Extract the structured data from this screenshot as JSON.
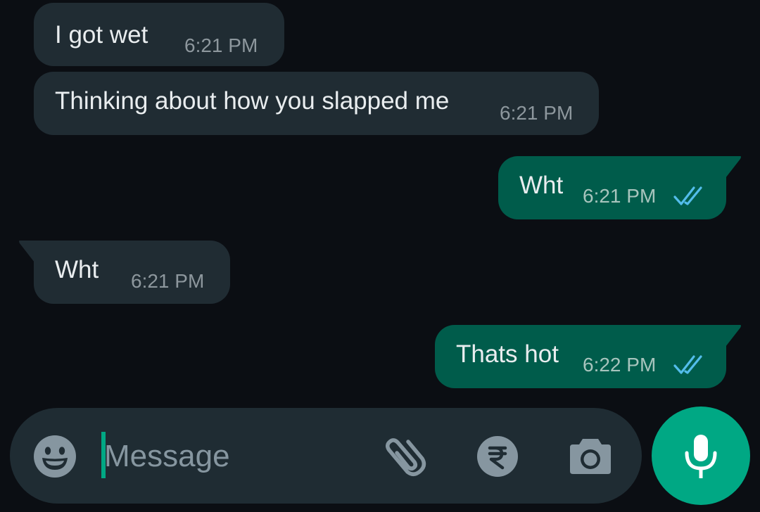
{
  "messages": [
    {
      "direction": "incoming",
      "text": "I got wet",
      "time": "6:21 PM"
    },
    {
      "direction": "incoming",
      "text": "Thinking about how you slapped me",
      "time": "6:21 PM"
    },
    {
      "direction": "outgoing",
      "text": "Wht",
      "time": "6:21 PM",
      "status": "read"
    },
    {
      "direction": "incoming",
      "text": "Wht",
      "time": "6:21 PM"
    },
    {
      "direction": "outgoing",
      "text": "Thats hot",
      "time": "6:22 PM",
      "status": "read"
    }
  ],
  "composer": {
    "placeholder": "Message",
    "icons": [
      "emoji-icon",
      "attach-icon",
      "rupee-payment-icon",
      "camera-icon",
      "mic-icon"
    ]
  },
  "colors": {
    "background": "#0b0e13",
    "incoming_bubble": "#202c33",
    "outgoing_bubble": "#005c4b",
    "read_ticks": "#53bdeb",
    "accent": "#00a884"
  }
}
